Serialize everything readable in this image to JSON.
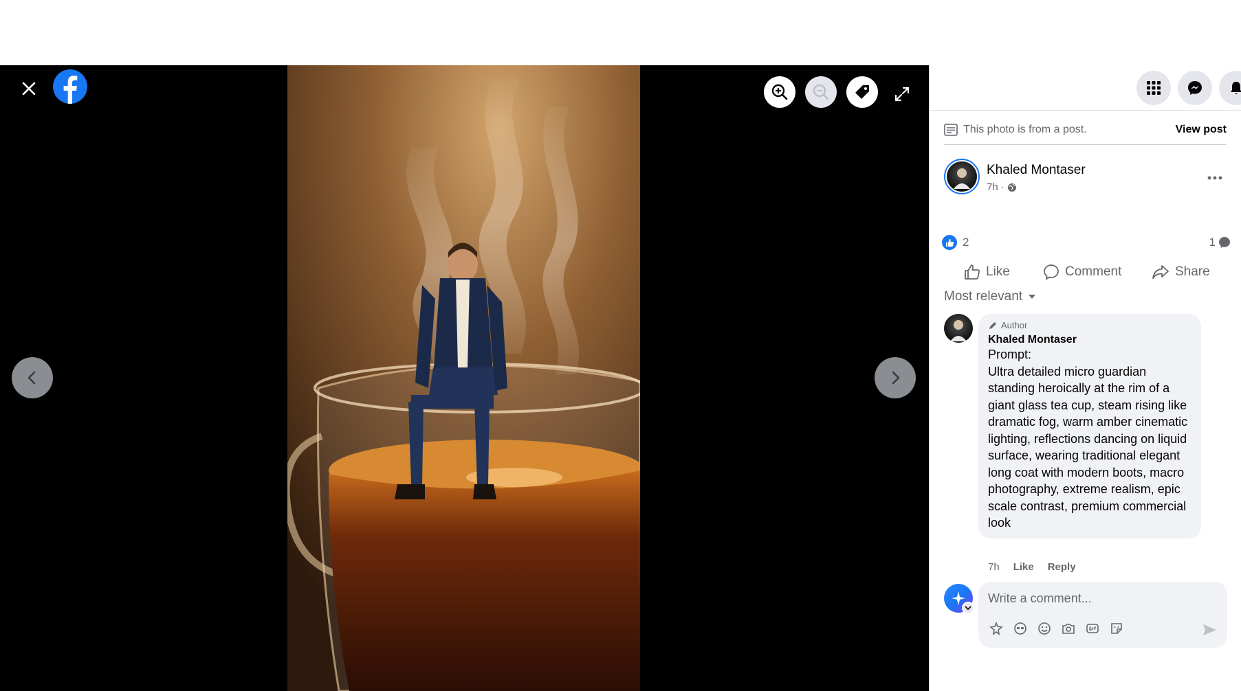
{
  "photo_caption_hidden": "",
  "viewer": {
    "close_icon": "close-icon",
    "logo": "facebook-logo",
    "tools": [
      "zoom-in-icon",
      "zoom-out-icon",
      "tag-icon",
      "fullscreen-icon"
    ],
    "prev_icon": "chevron-left-icon",
    "next_icon": "chevron-right-icon"
  },
  "sidebar": {
    "top_icons": [
      "menu-grid-icon",
      "messenger-icon",
      "bell-icon"
    ],
    "from_post_text": "This photo is from a post.",
    "view_post_label": "View post",
    "post": {
      "author": "Khaled Montaser",
      "time": "7h ·",
      "audience_icon": "globe-icon"
    },
    "reactions": {
      "count": "2",
      "comments": "1"
    },
    "actions": {
      "like": "Like",
      "comment": "Comment",
      "share": "Share"
    },
    "sort_label": "Most relevant",
    "comment": {
      "badge": "Author",
      "name": "Khaled Montaser",
      "text": "Prompt:\nUltra detailed micro guardian standing heroically at the rim of a giant glass tea cup, steam rising like dramatic fog, warm amber cinematic lighting, reflections dancing on liquid surface, wearing traditional elegant long coat with modern boots, macro photography, extreme realism, epic scale contrast, premium commercial look",
      "time": "7h",
      "like": "Like",
      "reply": "Reply"
    },
    "write": {
      "placeholder": "Write a comment..."
    }
  },
  "colors": {
    "brand": "#1877f2",
    "viewer_bg": "#000000",
    "bubble_bg": "#f0f2f5",
    "muted": "#65676b"
  }
}
